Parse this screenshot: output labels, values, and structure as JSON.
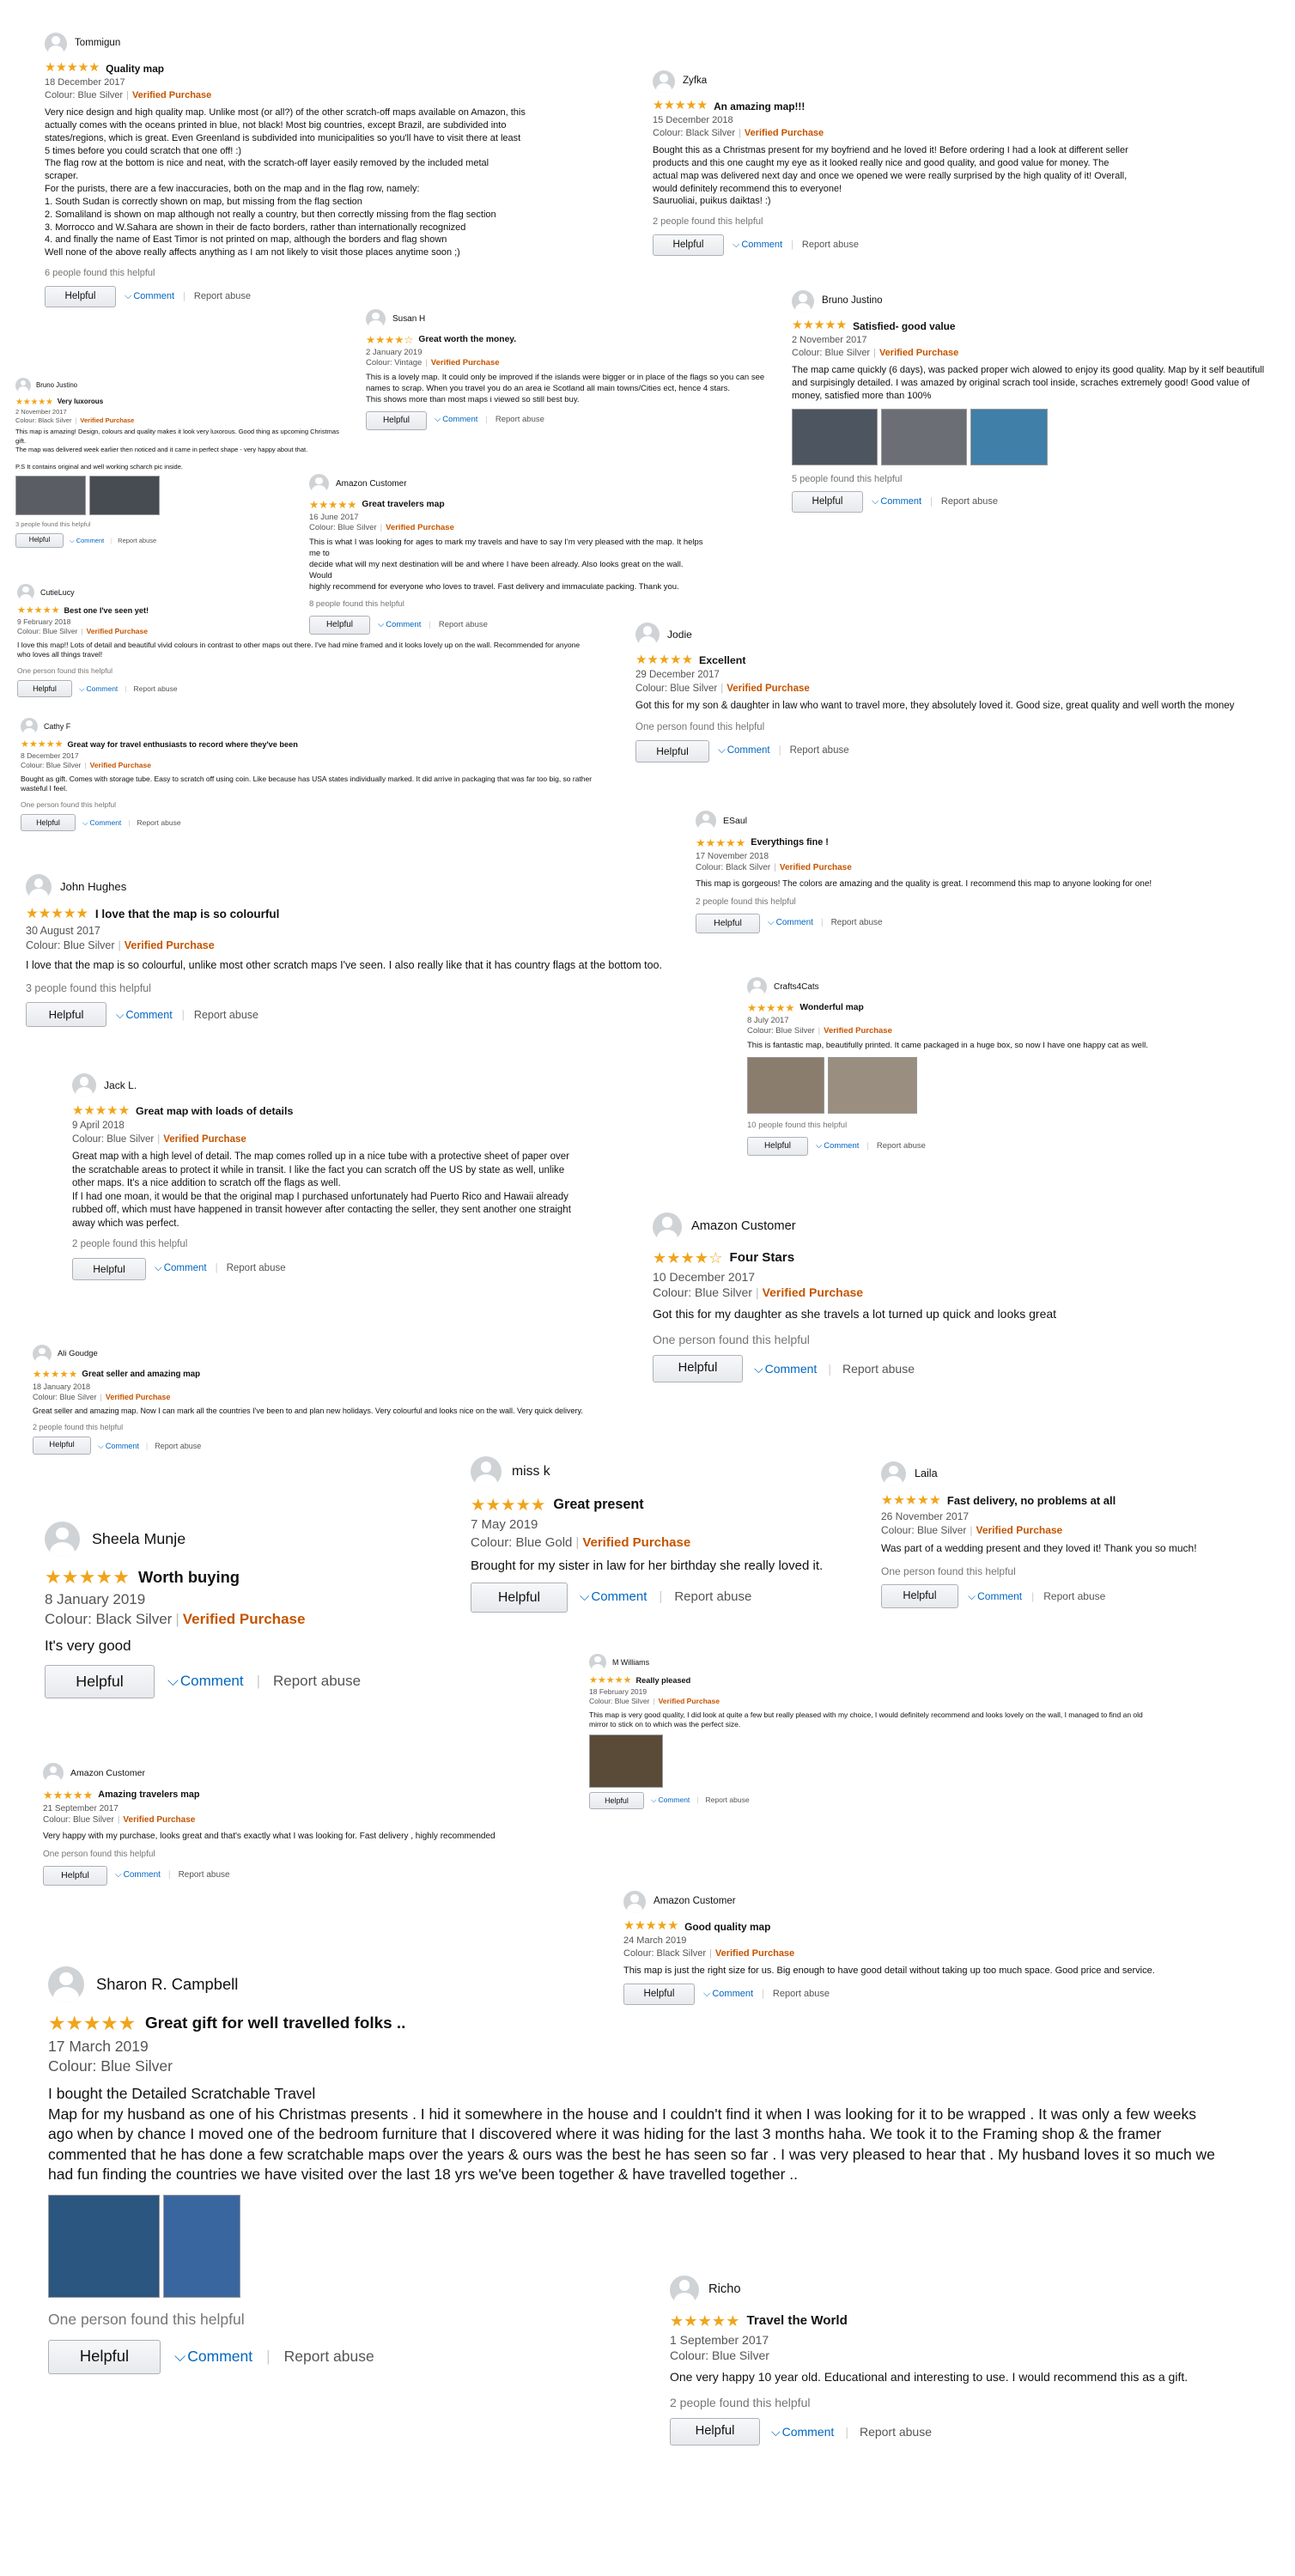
{
  "colors": {
    "star": "#f0a41b",
    "verified": "#c45500",
    "link": "#0066c0"
  },
  "reviews": [
    {
      "reviewer": "Tommigun",
      "stars": "★★★★★",
      "title": "Quality map",
      "date": "18 December 2017",
      "colour": "Colour: Blue Silver",
      "verified": "Verified Purchase",
      "text": "Very nice design and high quality map. Unlike most (or all?) of the other scratch-off maps available on Amazon, this\nactually comes with the oceans printed in blue, not black! Most big countries, except Brazil, are subdivided into\nstates/regions, which is great. Even Greenland is subdivided into municipalities so you'll have to visit there at least\n5 times before you could scratch that one off! :)\nThe flag row at the bottom is nice and neat, with the scratch-off layer easily removed by the included metal\nscraper.\nFor the purists, there are a few inaccuracies, both on the map and in the flag row, namely:\n1. South Sudan is correctly shown on map, but missing from the flag section\n2. Somaliland is shown on map although not really a country, but then correctly missing from the flag section\n3. Morrocco and W.Sahara are shown in their de facto borders, rather than internationally recognized\n4. and finally the name of East Timor is not printed on map, although the borders and flag shown\nWell none of the above really affects anything as I am not likely to visit those places anytime soon ;)",
      "found": "6 people found this helpful",
      "helpful": "Helpful",
      "comment": "Comment",
      "report": "Report abuse"
    },
    {
      "reviewer": "Zyfka",
      "stars": "★★★★★",
      "title": "An amazing map!!!",
      "date": "15 December 2018",
      "colour": "Colour: Black Silver",
      "verified": "Verified Purchase",
      "text": "Bought this as a Christmas present for my boyfriend and he loved it! Before ordering I had a look at different seller\nproducts and this one caught my eye as it looked really nice and good quality, and good value for money. The\nactual map was delivered next day and once we opened we were really surprised by the high quality of it! Overall,\nwould definitely recommend this to everyone!\nSauruoliai, puikus daiktas! :)",
      "found": "2 people found this helpful",
      "helpful": "Helpful",
      "comment": "Comment",
      "report": "Report abuse"
    },
    {
      "reviewer": "Susan H",
      "stars": "★★★★☆",
      "title": "Great worth the money.",
      "date": "2 January 2019",
      "colour": "Colour: Vintage",
      "verified": "Verified Purchase",
      "text": "This is a lovely map. It could only be improved if the islands were bigger or in place of the flags so you can see\nnames to scrap. When you travel you do an area ie Scotland all main towns/Cities ect, hence 4 stars.\nThis shows more than most maps i viewed so still best buy.",
      "helpful": "Helpful",
      "comment": "Comment",
      "report": "Report abuse"
    },
    {
      "reviewer": "Bruno Justino",
      "stars": "★★★★★",
      "title": "Satisfied- good value",
      "date": "2 November 2017",
      "colour": "Colour: Blue Silver",
      "verified": "Verified Purchase",
      "text": "The map came quickly (6 days), was packed proper wich alowed to enjoy its good quality. Map by it self beautifull\nand surpisingly detailed. I was amazed by original scrach tool inside, scraches extremely good! Good value of\nmoney, satisfied more than 100%",
      "found": "5 people found this helpful",
      "helpful": "Helpful",
      "comment": "Comment",
      "report": "Report abuse"
    },
    {
      "reviewer": "Bruno Justino",
      "stars": "★★★★★",
      "title": "Very luxorous",
      "date": "2 November 2017",
      "colour": "Colour: Black Silver",
      "verified": "Verified Purchase",
      "text": "This map is amazing! Design, colours and quality makes it look very luxorous. Good thing as upcoming Christmas\ngift.\nThe map was delivered week earlier then noticed and it came in perfect shape - very happy about that.\n\nP.S It contains original and well working scharch pic inside.",
      "found": "3 people found this helpful",
      "helpful": "Helpful",
      "comment": "Comment",
      "report": "Report abuse"
    },
    {
      "reviewer": "Amazon Customer",
      "stars": "★★★★★",
      "title": "Great travelers map",
      "date": "16 June 2017",
      "colour": "Colour: Blue Silver",
      "verified": "Verified Purchase",
      "text": "This is what I was looking for ages to mark my travels and have to say I'm very pleased with the map. It helps me to\ndecide what will my next destination will be and where I have been already. Also looks great on the wall. Would\nhighly recommend for everyone who loves to travel. Fast delivery and immaculate packing. Thank you.",
      "found": "8 people found this helpful",
      "helpful": "Helpful",
      "comment": "Comment",
      "report": "Report abuse"
    },
    {
      "reviewer": "CutieLucy",
      "stars": "★★★★★",
      "title": "Best one I've seen yet!",
      "date": "9 February 2018",
      "colour": "Colour: Blue Silver",
      "verified": "Verified Purchase",
      "text": "I love this map!! Lots of detail and beautiful vivid colours in contrast to other maps out there. I've had mine framed and it looks lovely up on the wall. Recommended for anyone\nwho loves all things travel!",
      "found": "One person found this helpful",
      "helpful": "Helpful",
      "comment": "Comment",
      "report": "Report abuse"
    },
    {
      "reviewer": "Jodie",
      "stars": "★★★★★",
      "title": "Excellent",
      "date": "29 December 2017",
      "colour": "Colour: Blue Silver",
      "verified": "Verified Purchase",
      "text": "Got this for my son & daughter in law who want to travel more, they absolutely loved it. Good size, great quality and well worth the money",
      "found": "One person found this helpful",
      "helpful": "Helpful",
      "comment": "Comment",
      "report": "Report abuse"
    },
    {
      "reviewer": "Cathy F",
      "stars": "★★★★★",
      "title": "Great way for travel enthusiasts to record where they've been",
      "date": "8 December 2017",
      "colour": "Colour: Blue Silver",
      "verified": "Verified Purchase",
      "text": "Bought as gift. Comes with storage tube. Easy to scratch off using coin. Like because has USA states individually marked. It did arrive in packaging that was far too big, so rather\nwasteful I feel.",
      "found": "One person found this helpful",
      "helpful": "Helpful",
      "comment": "Comment",
      "report": "Report abuse"
    },
    {
      "reviewer": "ESaul",
      "stars": "★★★★★",
      "title": "Everythings fine !",
      "date": "17 November 2018",
      "colour": "Colour: Black Silver",
      "verified": "Verified Purchase",
      "text": "This map is gorgeous! The colors are amazing and the quality is great. I recommend this map to anyone looking for one!",
      "found": "2 people found this helpful",
      "helpful": "Helpful",
      "comment": "Comment",
      "report": "Report abuse"
    },
    {
      "reviewer": "John Hughes",
      "stars": "★★★★★",
      "title": "I love that the map is so colourful",
      "date": "30 August 2017",
      "colour": "Colour: Blue Silver",
      "verified": "Verified Purchase",
      "text": "I love that the map is so colourful, unlike most other scratch maps I've seen. I also really like that it has country flags at the bottom too.",
      "found": "3 people found this helpful",
      "helpful": "Helpful",
      "comment": "Comment",
      "report": "Report abuse"
    },
    {
      "reviewer": "Crafts4Cats",
      "stars": "★★★★★",
      "title": "Wonderful map",
      "date": "8 July 2017",
      "colour": "Colour: Blue Silver",
      "verified": "Verified Purchase",
      "text": "This is fantastic map, beautifully printed. It came packaged in a huge box, so now I have one happy cat as well.",
      "found": "10 people found this helpful",
      "helpful": "Helpful",
      "comment": "Comment",
      "report": "Report abuse"
    },
    {
      "reviewer": "Jack L.",
      "stars": "★★★★★",
      "title": "Great map with loads of details",
      "date": "9 April 2018",
      "colour": "Colour: Blue Silver",
      "verified": "Verified Purchase",
      "text": "Great map with a high level of detail. The map comes rolled up in a nice tube with a protective sheet of paper over\nthe scratchable areas to protect it while in transit. I like the fact you can scratch off the US by state as well, unlike\nother maps. It's a nice addition to scratch off the flags as well.\nIf I had one moan, it would be that the original map I purchased unfortunately had Puerto Rico and Hawaii already\nrubbed off, which must have happened in transit however after contacting the seller, they sent another one straight\naway which was perfect.",
      "found": "2 people found this helpful",
      "helpful": "Helpful",
      "comment": "Comment",
      "report": "Report abuse"
    },
    {
      "reviewer": "Amazon Customer",
      "stars": "★★★★☆",
      "title": "Four Stars",
      "date": "10 December 2017",
      "colour": "Colour: Blue Silver",
      "verified": "Verified Purchase",
      "text": "Got this for my daughter as she travels a lot turned up quick and looks great",
      "found": "One person found this helpful",
      "helpful": "Helpful",
      "comment": "Comment",
      "report": "Report abuse"
    },
    {
      "reviewer": "Ali Goudge",
      "stars": "★★★★★",
      "title": "Great seller and amazing map",
      "date": "18 January 2018",
      "colour": "Colour: Blue Silver",
      "verified": "Verified Purchase",
      "text": "Great seller and amazing map. Now I can mark all the countries I've been to and plan new holidays. Very colourful and looks nice on the wall. Very quick delivery.",
      "found": "2 people found this helpful",
      "helpful": "Helpful",
      "comment": "Comment",
      "report": "Report abuse"
    },
    {
      "reviewer": "miss k",
      "stars": "★★★★★",
      "title": "Great present",
      "date": "7 May 2019",
      "colour": "Colour: Blue Gold",
      "verified": "Verified Purchase",
      "text": "Brought for my sister in law for her birthday she really loved it.",
      "helpful": "Helpful",
      "comment": "Comment",
      "report": "Report abuse"
    },
    {
      "reviewer": "Laila",
      "stars": "★★★★★",
      "title": "Fast delivery, no problems at all",
      "date": "26 November 2017",
      "colour": "Colour: Blue Silver",
      "verified": "Verified Purchase",
      "text": "Was part of a wedding present and they loved it! Thank you so much!",
      "found": "One person found this helpful",
      "helpful": "Helpful",
      "comment": "Comment",
      "report": "Report abuse"
    },
    {
      "reviewer": "Sheela Munje",
      "stars": "★★★★★",
      "title": "Worth buying",
      "date": "8 January 2019",
      "colour": "Colour: Black Silver",
      "verified": "Verified Purchase",
      "text": "It's very good",
      "helpful": "Helpful",
      "comment": "Comment",
      "report": "Report abuse"
    },
    {
      "reviewer": "M Williams",
      "stars": "★★★★★",
      "title": "Really pleased",
      "date": "18 February 2019",
      "colour": "Colour: Blue Silver",
      "verified": "Verified Purchase",
      "text": "This map is very good quality, I did look at quite a few but really pleased with my choice, I would definitely recommend and looks lovely on the wall, I managed to find an old\nmirror to stick on to which was the perfect size.",
      "helpful": "Helpful",
      "comment": "Comment",
      "report": "Report abuse"
    },
    {
      "reviewer": "Amazon Customer",
      "stars": "★★★★★",
      "title": "Amazing travelers map",
      "date": "21 September 2017",
      "colour": "Colour: Blue Silver",
      "verified": "Verified Purchase",
      "text": "Very happy with my purchase, looks great and that's exactly what I was looking for. Fast delivery , highly recommended",
      "found": "One person found this helpful",
      "helpful": "Helpful",
      "comment": "Comment",
      "report": "Report abuse"
    },
    {
      "reviewer": "Amazon Customer",
      "stars": "★★★★★",
      "title": "Good quality map",
      "date": "24 March 2019",
      "colour": "Colour: Black Silver",
      "verified": "Verified Purchase",
      "text": "This map is just the right size for us. Big enough to have good detail without taking up too much space. Good price and service.",
      "helpful": "Helpful",
      "comment": "Comment",
      "report": "Report abuse"
    },
    {
      "reviewer": "Sharon R. Campbell",
      "stars": "★★★★★",
      "title": "Great gift for well travelled folks ..",
      "date": "17 March 2019",
      "colour": "Colour: Blue Silver",
      "text": "I bought the Detailed Scratchable Travel\nMap for my husband as one of his Christmas presents . I hid it somewhere in the house and I couldn't find it when I was looking for it to be wrapped . It was only a few weeks\nago when by chance I moved one of the bedroom furniture that I discovered where it was hiding for the last 3 months haha. We took it to the Framing shop & the framer\ncommented that he has done a few scratchable maps over the years & ours was the best he has seen so far . I was very pleased to hear that . My husband loves it so much we\nhad fun finding the countries we have visited over the last 18 yrs we've been together & have travelled together ..",
      "found": "One person found this helpful",
      "helpful": "Helpful",
      "comment": "Comment",
      "report": "Report abuse"
    },
    {
      "reviewer": "Richo",
      "stars": "★★★★★",
      "title": "Travel the World",
      "date": "1 September 2017",
      "colour": "Colour: Blue Silver",
      "text": "One very happy 10 year old. Educational and interesting to use. I would recommend this as a gift.",
      "found": "2 people found this helpful",
      "helpful": "Helpful",
      "comment": "Comment",
      "report": "Report abuse"
    }
  ]
}
